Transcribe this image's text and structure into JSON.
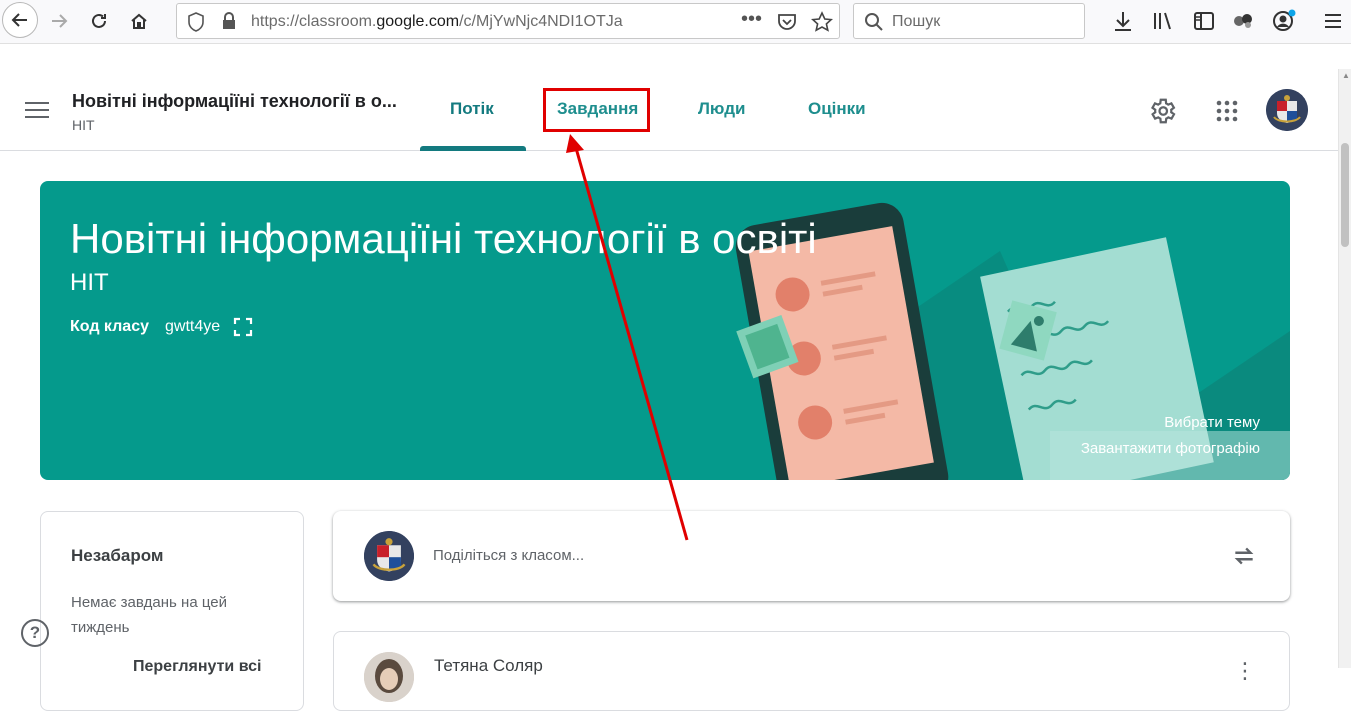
{
  "browser": {
    "url_prefix": "https://classroom.",
    "url_domain": "google.com",
    "url_path": "/c/MjYwNjc4NDI1OTJa",
    "search_placeholder": "Пошук"
  },
  "header": {
    "class_title": "Новітні інформаціїні технології в о...",
    "class_subtitle": "НІТ",
    "tabs": [
      {
        "label": "Потік",
        "active": true
      },
      {
        "label": "Завдання",
        "active": false
      },
      {
        "label": "Люди",
        "active": false
      },
      {
        "label": "Оцінки",
        "active": false
      }
    ]
  },
  "banner": {
    "title": "Новітні інформаціїні технології в освіті",
    "subtitle": "НІТ",
    "code_label": "Код класу",
    "code_value": "gwtt4ye",
    "select_theme": "Вибрати тему",
    "upload_photo": "Завантажити фотографію"
  },
  "upcoming": {
    "title": "Незабаром",
    "empty_text": "Немає завдань на цей тиждень",
    "view_all": "Переглянути всі"
  },
  "share": {
    "placeholder": "Поділіться з класом..."
  },
  "post": {
    "author": "Тетяна Соляр"
  },
  "colors": {
    "accent": "#1e8e8e",
    "banner": "#059a8c",
    "annotation": "#e00000"
  }
}
